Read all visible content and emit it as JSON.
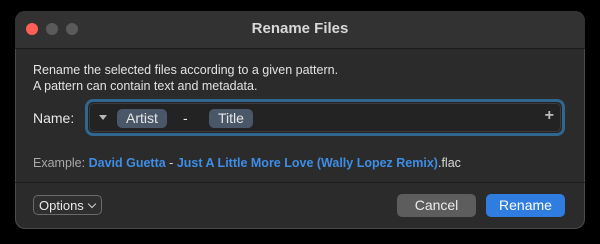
{
  "window": {
    "title": "Rename Files"
  },
  "description": {
    "line1": "Rename the selected files according to a given pattern.",
    "line2": "A pattern can contain text and metadata."
  },
  "pattern": {
    "label": "Name:",
    "tokens": [
      "Artist",
      "Title"
    ],
    "separator": "-",
    "add_glyph": "+"
  },
  "example": {
    "label": "Example:",
    "artist": "David Guetta",
    "separator": " - ",
    "title": "Just A Little More Love (Wally Lopez Remix)",
    "extension": ".flac"
  },
  "buttons": {
    "options": "Options",
    "cancel": "Cancel",
    "rename": "Rename"
  },
  "colors": {
    "accent": "#2f7de1",
    "token_bg": "#4a5769",
    "close": "#ff5f57"
  }
}
